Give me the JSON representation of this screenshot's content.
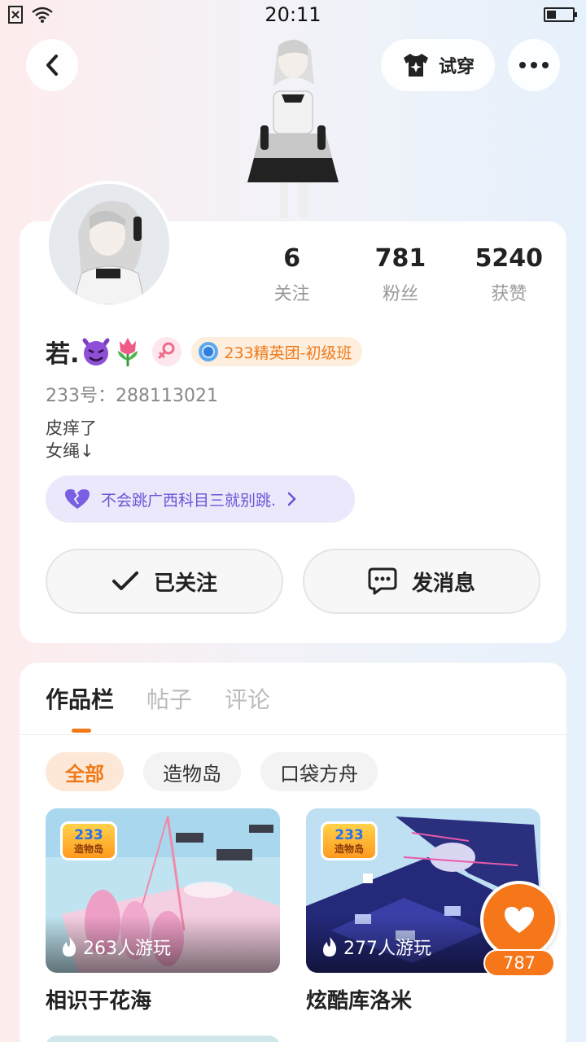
{
  "status_bar": {
    "time": "20:11",
    "battery_level": 0.35
  },
  "header": {
    "tryon_label": "试穿"
  },
  "profile": {
    "stats": [
      {
        "value": "6",
        "label": "关注"
      },
      {
        "value": "781",
        "label": "粉丝"
      },
      {
        "value": "5240",
        "label": "获赞"
      }
    ],
    "name_text": "若.",
    "name_emojis": [
      "devil-emoji",
      "tulip-emoji"
    ],
    "gender_icon": "female-symbol-icon",
    "level_badge": "233精英团-初级班",
    "uid": "233号：288113021",
    "bio_lines": [
      "皮痒了",
      "女绳↓"
    ],
    "music_text": "不会跳广西科目三就别跳.",
    "follow_label": "已关注",
    "message_label": "发消息"
  },
  "works": {
    "tabs": [
      "作品栏",
      "帖子",
      "评论"
    ],
    "filters": [
      "全部",
      "造物岛",
      "口袋方舟"
    ],
    "logo_text": {
      "num": "233",
      "sub": "造物岛"
    },
    "games": [
      {
        "title": "相识于花海",
        "plays": "263人游玩"
      },
      {
        "title": "炫酷库洛米",
        "plays": "277人游玩"
      }
    ]
  },
  "like_button": {
    "count": "787"
  },
  "colors": {
    "accent": "#f07a1a",
    "like": "#f6761a",
    "music_pill": "#ebe8fb",
    "music_text": "#6a55d6"
  }
}
